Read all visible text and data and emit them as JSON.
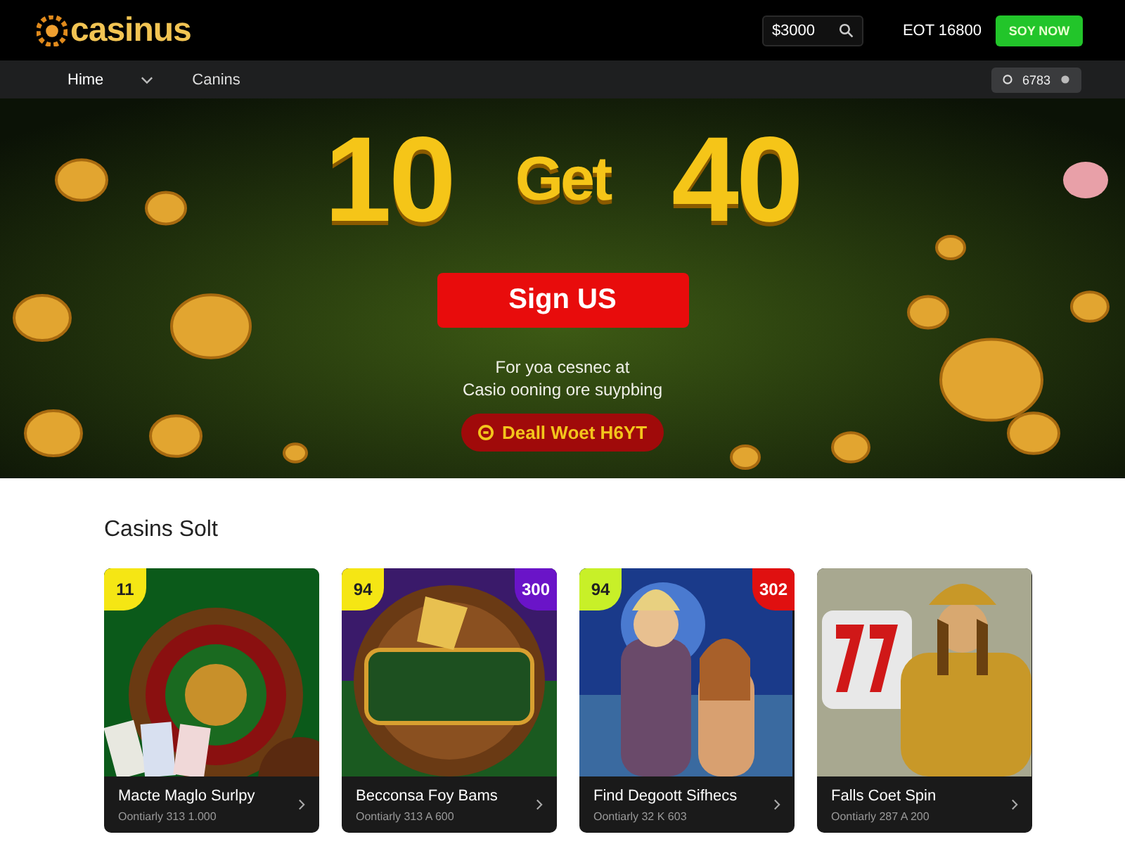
{
  "header": {
    "logo": "casinus",
    "search": {
      "value": "$3000"
    },
    "balance": "EOT 16800",
    "cta": "SOY NOW"
  },
  "nav": {
    "items": [
      {
        "label": "Hime",
        "selected": true,
        "dropdown": true
      },
      {
        "label": "Canins",
        "selected": false,
        "dropdown": false
      }
    ],
    "account_pill": "6783"
  },
  "hero": {
    "kind": "picture",
    "headline": [
      "10",
      "Get",
      "40"
    ],
    "button": "Sign US",
    "lines": [
      "For yoa cesnec at",
      "Casio ooning ore suypbing"
    ],
    "deal": "Deall Woet H6YT"
  },
  "section": {
    "title": "Casins Solt"
  },
  "cards": [
    {
      "kind": "picture",
      "title": "Macte Maglo Surlpy",
      "subtitle": "Oontiarly 313 1.000",
      "badge_left": {
        "text": "11",
        "color": "#f5e614"
      }
    },
    {
      "kind": "picture",
      "title": "Becconsa Foy Bams",
      "subtitle": "Oontiarly 313 A 600",
      "badge_left": {
        "text": "94",
        "color": "#f5e614"
      },
      "badge_right": {
        "text": "300",
        "color": "#6a14c8"
      }
    },
    {
      "kind": "picture",
      "title": "Find Degoott Sifhecs",
      "subtitle": "Oontiarly 32 K 603",
      "badge_left": {
        "text": "94",
        "color": "#c8f028"
      },
      "badge_right": {
        "text": "302",
        "color": "#e01010"
      }
    },
    {
      "kind": "picture",
      "title": "Falls Coet Spin",
      "subtitle": "Oontiarly 287 A 200"
    }
  ]
}
